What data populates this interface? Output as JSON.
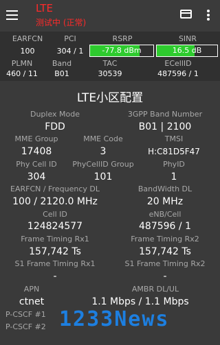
{
  "appbar": {
    "title": "LTE",
    "subtitle": "测试中 (正常)",
    "icons": [
      "menu-icon",
      "card-icon",
      "more-vert-icon"
    ]
  },
  "summary": {
    "headers1": [
      "EARFCN",
      "PCI",
      "RSRP",
      "SINR"
    ],
    "values1": {
      "earfcn": "100",
      "pci": "304 / 1",
      "rsrp": "-77.8 dBm",
      "sinr": "16.5 dB"
    },
    "rsrp_level": 0.78,
    "sinr_level": 0.62,
    "bar_color": "#2ecb2e",
    "headers2": [
      "PLMN",
      "Band",
      "TAC",
      "ECellID"
    ],
    "values2": {
      "plmn": "460 / 11",
      "band": "B01",
      "tac": "30539",
      "ecellid": "487596 / 1"
    }
  },
  "section": {
    "title": "LTE小区配置"
  },
  "config": {
    "duplex_mode_label": "Duplex Mode",
    "duplex_mode": "FDD",
    "band_number_label": "3GPP Band Number",
    "band_number": "B01 | 2100",
    "mme_group_label": "MME Group",
    "mme_group": "17408",
    "mme_code_label": "MME Code",
    "mme_code": "3",
    "tmsi_label": "TMSI",
    "tmsi": "H:C81D5F47",
    "phy_cell_id_label": "Phy Cell ID",
    "phy_cell_id": "304",
    "phycellid_group_label": "PhyCellID Group",
    "phycellid_group": "101",
    "phyid_label": "PhyID",
    "phyid": "1",
    "earfcn_freq_label": "EARFCN / Frequency DL",
    "earfcn_freq": "100 / 2120.0 MHz",
    "bandwidth_label": "BandWidth DL",
    "bandwidth": "20 MHz",
    "cell_id_label": "Cell ID",
    "cell_id": "124824577",
    "enb_cell_label": "eNB/Cell",
    "enb_cell": "487596 / 1",
    "frame_rx1_label": "Frame Timing Rx1",
    "frame_rx1": "157,742 Ts",
    "frame_rx2_label": "Frame Timing Rx2",
    "frame_rx2": "157,742 Ts",
    "s1_rx1_label": "S1 Frame Timing Rx1",
    "s1_rx1": "-",
    "s1_rx2_label": "S1 Frame Timing Rx2",
    "s1_rx2": "-",
    "apn_label": "APN",
    "apn": "ctnet",
    "ambr_label": "AMBR DL/UL",
    "ambr": "1.1 Mbps / 1.1 Mbps",
    "pcscf1_label": "P-CSCF #1",
    "pcscf2_label": "P-CSCF #2"
  },
  "watermark": "1233News"
}
